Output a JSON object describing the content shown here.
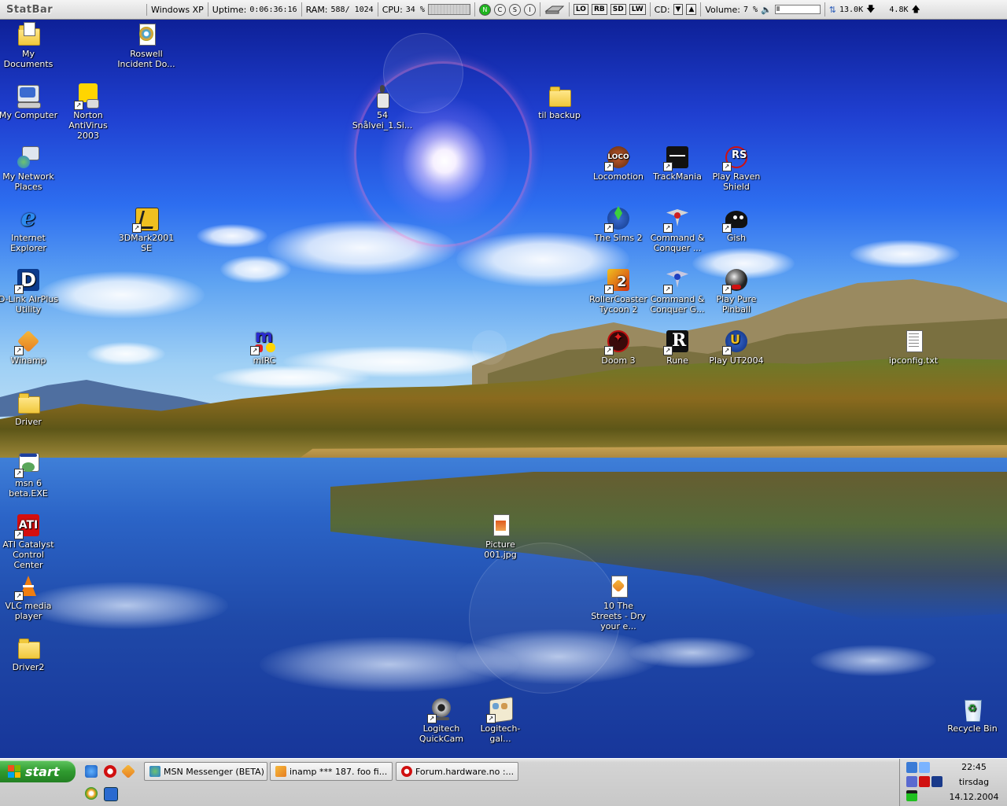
{
  "statbar": {
    "brand": "StatBar",
    "os": "Windows XP",
    "uptime_label": "Uptime:",
    "uptime_value": "0:06:36:16",
    "ram_label": "RAM:",
    "ram_value": "588/ 1024",
    "cpu_label": "CPU:",
    "cpu_value": "34 %",
    "buttons": [
      "N",
      "C",
      "S",
      "I"
    ],
    "mode_buttons": [
      "LO",
      "RB",
      "SD",
      "LW"
    ],
    "cd_label": "CD:",
    "volume_label": "Volume:",
    "volume_value": "7 %",
    "volume_level": 0.07,
    "net_down": "13.0K",
    "net_up": "4.8K"
  },
  "icons": [
    {
      "label": "My Documents",
      "icon": "my-documents-icon"
    },
    {
      "label": "Roswell Incident Do...",
      "icon": "media-file-icon"
    },
    {
      "label": "My Computer",
      "icon": "my-computer-icon"
    },
    {
      "label": "Norton AntiVirus 2003",
      "icon": "norton-antivirus-icon"
    },
    {
      "label": "54 Snålvei_1.Si...",
      "icon": "bottle-file-icon"
    },
    {
      "label": "til backup",
      "icon": "folder-icon"
    },
    {
      "label": "My Network Places",
      "icon": "network-places-icon"
    },
    {
      "label": "Locomotion",
      "icon": "locomotion-icon"
    },
    {
      "label": "TrackMania",
      "icon": "trackmania-icon"
    },
    {
      "label": "Play Raven Shield",
      "icon": "raven-shield-icon"
    },
    {
      "label": "Internet Explorer",
      "icon": "internet-explorer-icon"
    },
    {
      "label": "3DMark2001 SE",
      "icon": "3dmark-icon"
    },
    {
      "label": "The Sims 2",
      "icon": "sims2-icon"
    },
    {
      "label": "Command & Conquer ...",
      "icon": "command-conquer-icon"
    },
    {
      "label": "Gish",
      "icon": "gish-icon"
    },
    {
      "label": "D-Link AirPlus Utility",
      "icon": "dlink-icon"
    },
    {
      "label": "RollerCoaster Tycoon 2",
      "icon": "rollercoaster-icon"
    },
    {
      "label": "Command & Conquer G...",
      "icon": "command-conquer-generals-icon"
    },
    {
      "label": "Play Pure Pinball",
      "icon": "pinball-icon"
    },
    {
      "label": "Winamp",
      "icon": "winamp-icon"
    },
    {
      "label": "mIRC",
      "icon": "mirc-icon"
    },
    {
      "label": "Doom 3",
      "icon": "doom3-icon"
    },
    {
      "label": "Rune",
      "icon": "rune-icon"
    },
    {
      "label": "Play UT2004",
      "icon": "ut2004-icon"
    },
    {
      "label": "ipconfig.txt",
      "icon": "text-file-icon"
    },
    {
      "label": "Driver",
      "icon": "folder-icon"
    },
    {
      "label": "msn 6 beta.EXE",
      "icon": "exe-file-icon"
    },
    {
      "label": "ATI Catalyst Control Center",
      "icon": "ati-icon"
    },
    {
      "label": "Picture 001.jpg",
      "icon": "image-file-icon"
    },
    {
      "label": "VLC media player",
      "icon": "vlc-icon"
    },
    {
      "label": "10 The Streets - Dry your e...",
      "icon": "audio-file-icon"
    },
    {
      "label": "Driver2",
      "icon": "folder-icon"
    },
    {
      "label": "Logitech QuickCam",
      "icon": "webcam-icon"
    },
    {
      "label": "Logitech-gal...",
      "icon": "gallery-icon"
    },
    {
      "label": "Recycle Bin",
      "icon": "recycle-bin-icon"
    }
  ],
  "taskbar": {
    "start_label": "start",
    "tasks": [
      {
        "label": "MSN Messenger (BETA)",
        "icon": "msn-icon"
      },
      {
        "label": "inamp *** 187. foo fi...",
        "icon": "winamp-icon"
      },
      {
        "label": "Forum.hardware.no :...",
        "icon": "opera-icon"
      }
    ],
    "quicklaunch": [
      "internet-explorer-icon",
      "opera-icon",
      "winamp-icon",
      "media-player-icon",
      "outlook-icon"
    ],
    "clock": {
      "time": "22:45",
      "day": "tirsdag",
      "date": "14.12.2004"
    }
  },
  "colors": {
    "start_green": "#2f9a2f",
    "icon_text": "#ffffff",
    "statbar_bg": "#e0e0e0"
  }
}
